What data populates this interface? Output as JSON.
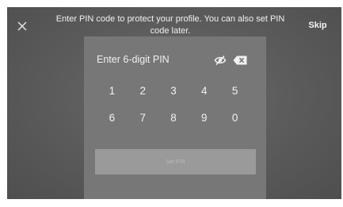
{
  "header": {
    "close_icon": "close-icon",
    "message": "Enter PIN code to protect your profile. You can also set PIN code later.",
    "skip_label": "Skip"
  },
  "pin_panel": {
    "label": "Enter 6-digit PIN",
    "visibility_icon": "eye-off-icon",
    "backspace_icon": "backspace-icon",
    "keys": [
      "1",
      "2",
      "3",
      "4",
      "5",
      "6",
      "7",
      "8",
      "9",
      "0"
    ],
    "set_pin_label": "Set PIN",
    "set_pin_enabled": false
  },
  "colors": {
    "background": "#5a5a5a",
    "panel": "#777777",
    "button_disabled": "#9a9a9a",
    "text": "#f0f0f0"
  }
}
